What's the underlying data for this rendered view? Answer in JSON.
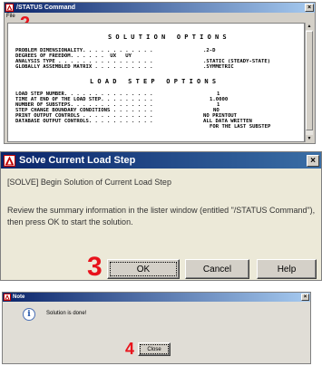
{
  "status_window": {
    "title": "/STATUS Command",
    "menu_file": "File",
    "step_number": "2",
    "heading_solution": "S O L U T I O N   O P T I O N S",
    "solution_rows": [
      {
        "label": "PROBLEM DIMENSIONALITY. . . . . . . . . . . .",
        "value": ".2-D"
      },
      {
        "label": "DEGREES OF FREEDOM. . . . . .  UX   UY",
        "value": ""
      },
      {
        "label": "ANALYSIS TYPE . . . . . . . . . . . . . . . .",
        "value": ".STATIC (STEADY-STATE)"
      },
      {
        "label": "GLOBALLY ASSEMBLED MATRIX . . . . . . . . . .",
        "value": ".SYMMETRIC"
      }
    ],
    "heading_loadstep": "L O A D   S T E P   O P T I O N S",
    "loadstep_rows": [
      {
        "label": "LOAD STEP NUMBER. . . . . . . . . . . . . . .",
        "value": "1"
      },
      {
        "label": "TIME AT END OF THE LOAD STEP. . . . . . . . .",
        "value": "1.0000"
      },
      {
        "label": "NUMBER OF SUBSTEPS. . . . . . . . . . . . . .",
        "value": "1"
      },
      {
        "label": "STEP CHANGE BOUNDARY CONDITIONS . . . . . . .",
        "value": "NO"
      },
      {
        "label": "PRINT OUTPUT CONTROLS . . . . . . . . . . . .",
        "value": "NO PRINTOUT"
      },
      {
        "label": "DATABASE OUTPUT CONTROLS. . . . . . . . . . .",
        "value": "ALL DATA WRITTEN"
      },
      {
        "label": "",
        "value": "FOR THE LAST SUBSTEP"
      }
    ]
  },
  "solve_window": {
    "title": "Solve Current Load Step",
    "line1": "[SOLVE] Begin Solution of Current Load Step",
    "line2": "Review the summary information in the lister window (entitled \"/STATUS Command\"), then press OK to start the solution.",
    "step_number": "3",
    "ok_label": "OK",
    "cancel_label": "Cancel",
    "help_label": "Help"
  },
  "note_window": {
    "title": "Note",
    "message": "Solution is done!",
    "step_number": "4",
    "close_label": "Close"
  },
  "icons": {
    "app_logo": "ansys-logo-icon",
    "close": "close-icon",
    "info": "info-icon"
  },
  "colors": {
    "titlebar_start": "#0a246a",
    "titlebar_end": "#a6caf0",
    "step_number": "#e8131c"
  }
}
